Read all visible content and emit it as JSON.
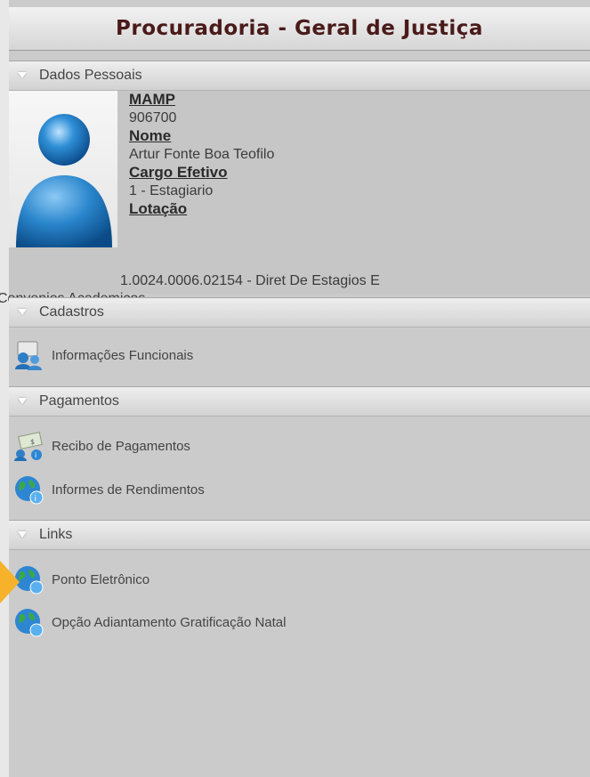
{
  "header": {
    "title": "Procuradoria - Geral de Justiça"
  },
  "sections": {
    "dados_pessoais": "Dados Pessoais",
    "cadastros": "Cadastros",
    "pagamentos": "Pagamentos",
    "links": "Links"
  },
  "profile": {
    "mamp_label": "MAMP",
    "mamp_value": "906700",
    "nome_label": "Nome",
    "nome_value": "Artur Fonte Boa Teofilo",
    "cargo_label": "Cargo Efetivo",
    "cargo_value": "1 - Estagiario",
    "lotacao_label": "Lotação",
    "lotacao_value_line1": "1.0024.0006.02154 - Diret De Estagios E",
    "lotacao_value_line2": "Convenios Academicos"
  },
  "menu": {
    "informacoes_funcionais": "Informações Funcionais",
    "recibo_pagamentos": "Recibo de Pagamentos",
    "informes_rendimentos": "Informes de Rendimentos",
    "ponto_eletronico": "Ponto Eletrônico",
    "opcao_adiantamento": "Opção Adiantamento Gratificação Natal"
  },
  "colors": {
    "title": "#4a1a1a",
    "arrow": "#f5b22a",
    "text": "#444444"
  },
  "icons": [
    "user-avatar-icon",
    "users-info-icon",
    "money-receipt-icon",
    "globe-icon"
  ]
}
